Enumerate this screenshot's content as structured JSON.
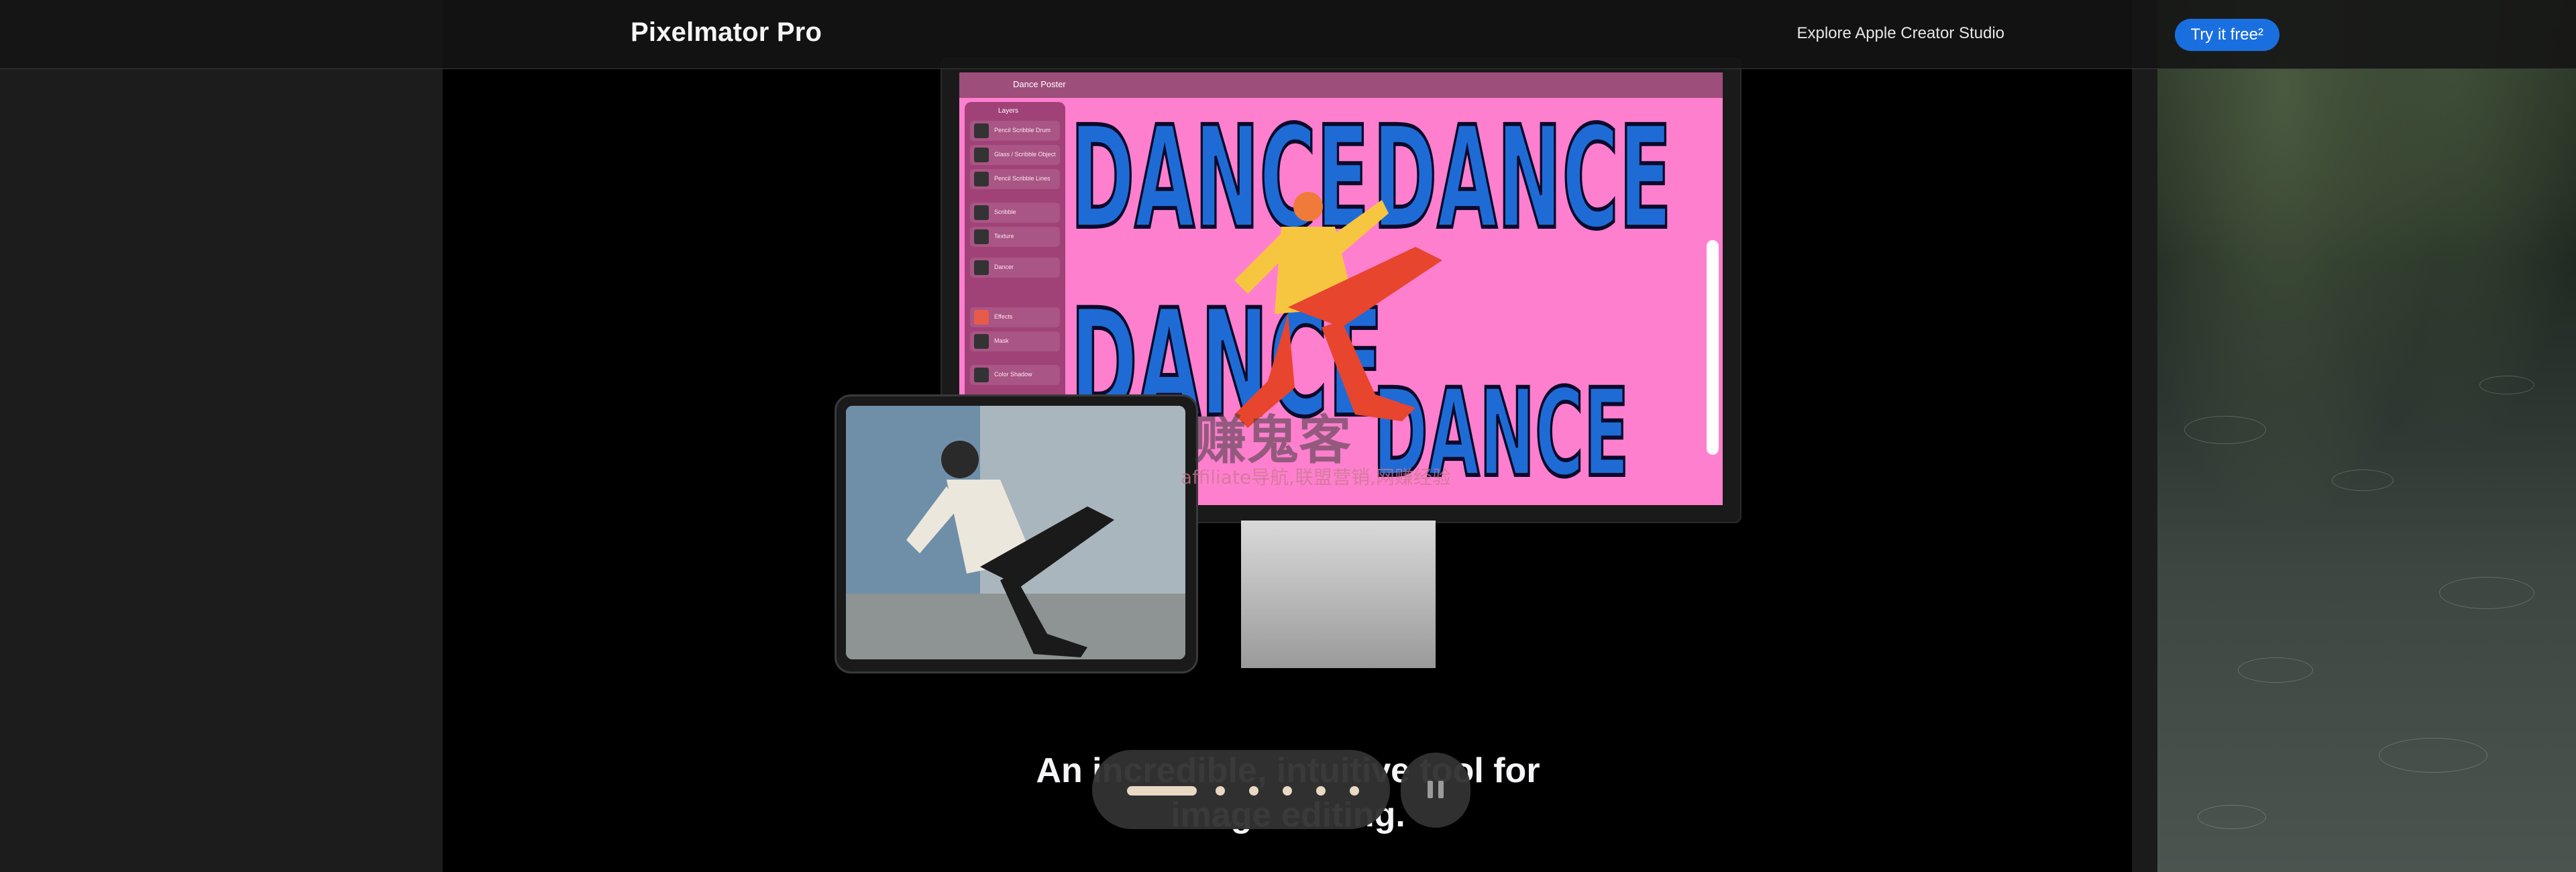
{
  "nav": {
    "brand": "Pixelmator Pro",
    "explore_link": "Explore Apple Creator Studio",
    "try_button": "Try it free²"
  },
  "monitor": {
    "document_title": "Dance Poster",
    "artwork_text": [
      "DANCE",
      "DANCE",
      "DANCE",
      "DANCE"
    ],
    "layers_panel_title": "Layers",
    "layers": [
      "Pencil Scribble Drum",
      "Glass / Scribble Object",
      "Pencil Scribble Lines",
      "Scribble",
      "Texture",
      "Dancer",
      "Effects",
      "Mask",
      "Color Shadow"
    ]
  },
  "watermark": {
    "line1": "赚鬼客",
    "line2": "affiliate导航,联盟营销,网赚经验"
  },
  "headline": {
    "line1": "An incredible, intuitive tool for",
    "line2": "image editing."
  },
  "pager": {
    "total_slides": 6,
    "active_index": 0,
    "pause_icon": "pause-icon"
  },
  "colors": {
    "accent": "#1a6fe0",
    "pager_fill": "#e8d8c4",
    "artwork_pink": "#ff7fcf",
    "artwork_blue": "#1f6bd6"
  }
}
